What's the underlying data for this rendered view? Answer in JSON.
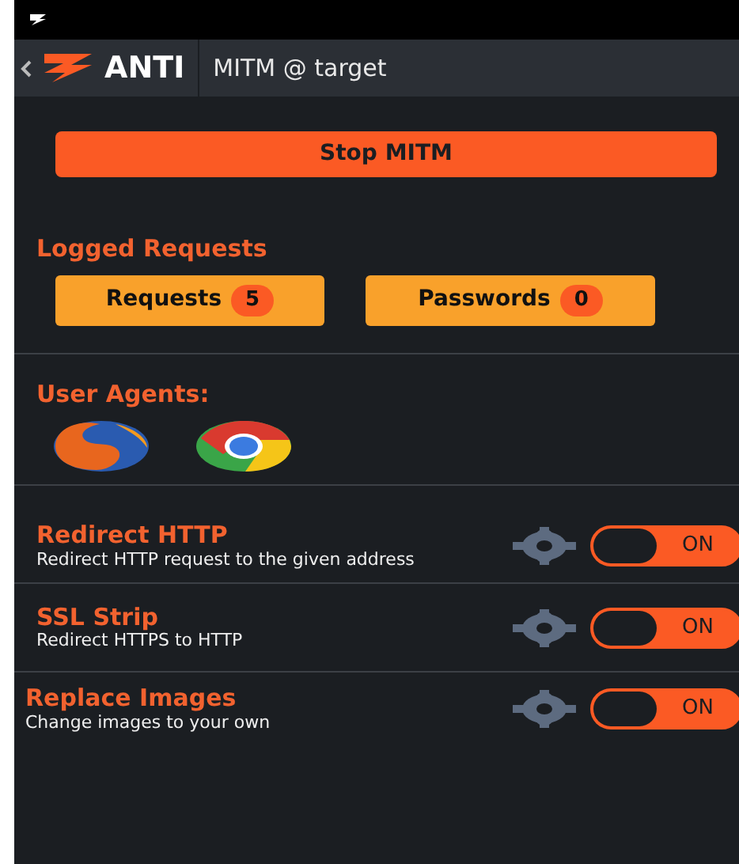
{
  "header": {
    "logo_text": "ANTI",
    "title": "MITM @ target"
  },
  "stop_button": "Stop MITM",
  "logged_requests": {
    "title": "Logged Requests",
    "buttons": [
      {
        "label": "Requests",
        "count": "5"
      },
      {
        "label": "Passwords",
        "count": "0"
      }
    ]
  },
  "user_agents": {
    "title": "User Agents:",
    "agents": [
      {
        "kind": "firefox"
      },
      {
        "kind": "chrome"
      }
    ]
  },
  "modules": [
    {
      "title": "Redirect HTTP",
      "description": "Redirect HTTP request to the given address",
      "on": true,
      "toggle_label": "ON"
    },
    {
      "title": "SSL Strip",
      "description": "Redirect HTTPS to HTTP",
      "on": true,
      "toggle_label": "ON"
    },
    {
      "title": "Replace Images",
      "description": "Change images to your own",
      "on": true,
      "toggle_label": "ON"
    }
  ]
}
